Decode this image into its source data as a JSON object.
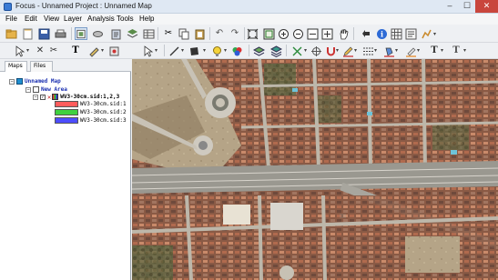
{
  "window": {
    "title": "Focus - Unnamed Project : Unnamed Map"
  },
  "menu": [
    "File",
    "Edit",
    "View",
    "Layer",
    "Analysis",
    "Tools",
    "Help"
  ],
  "toolbar1_icons": [
    "folder-open-icon",
    "new-file-icon",
    "save-icon",
    "print-icon",
    "copy-map-icon",
    "layers-icon",
    "paste-icon",
    "cut-icon",
    "copy-icon",
    "clipboard-icon",
    "undo-icon",
    "redo-icon",
    "fit-extent-icon",
    "zoom-window-icon",
    "zoom-in-icon",
    "zoom-out-icon",
    "zoom-previous-icon",
    "zoom-next-icon",
    "pan-icon",
    "refresh-icon",
    "identify-icon",
    "info-icon",
    "table-icon",
    "grid-icon",
    "chart-icon"
  ],
  "toolbar2_icons": [
    "select-arrow-icon",
    "cross-icon",
    "scissors-icon",
    "text-tool-icon",
    "annotation-icon",
    "pointer-icon",
    "line-tool-icon",
    "polygon-tool-icon",
    "point-tool-icon",
    "bulb-icon",
    "gradient-icon",
    "stack-icon",
    "layers-alt-icon",
    "node-icon",
    "snap-icon",
    "magnet-icon",
    "pencil-icon",
    "line-style-icon",
    "fill-icon",
    "brush-icon",
    "text-style-icon",
    "text-color-icon"
  ],
  "tabs": {
    "maps": "Maps",
    "files": "Files"
  },
  "tree": {
    "map_name": "Unnamed Map",
    "area_name": "New Area",
    "layer_name": "WV3-30cm.sid:1,2,3",
    "bands": [
      {
        "label": "WV3-30cm.sid:1",
        "color": "#ff5c5c"
      },
      {
        "label": "WV3-30cm.sid:2",
        "color": "#3fd13f"
      },
      {
        "label": "WV3-30cm.sid:3",
        "color": "#4d4dff"
      }
    ]
  },
  "colors": {
    "close_button": "#c9463d",
    "tree_blue": "#1a2fb0"
  }
}
